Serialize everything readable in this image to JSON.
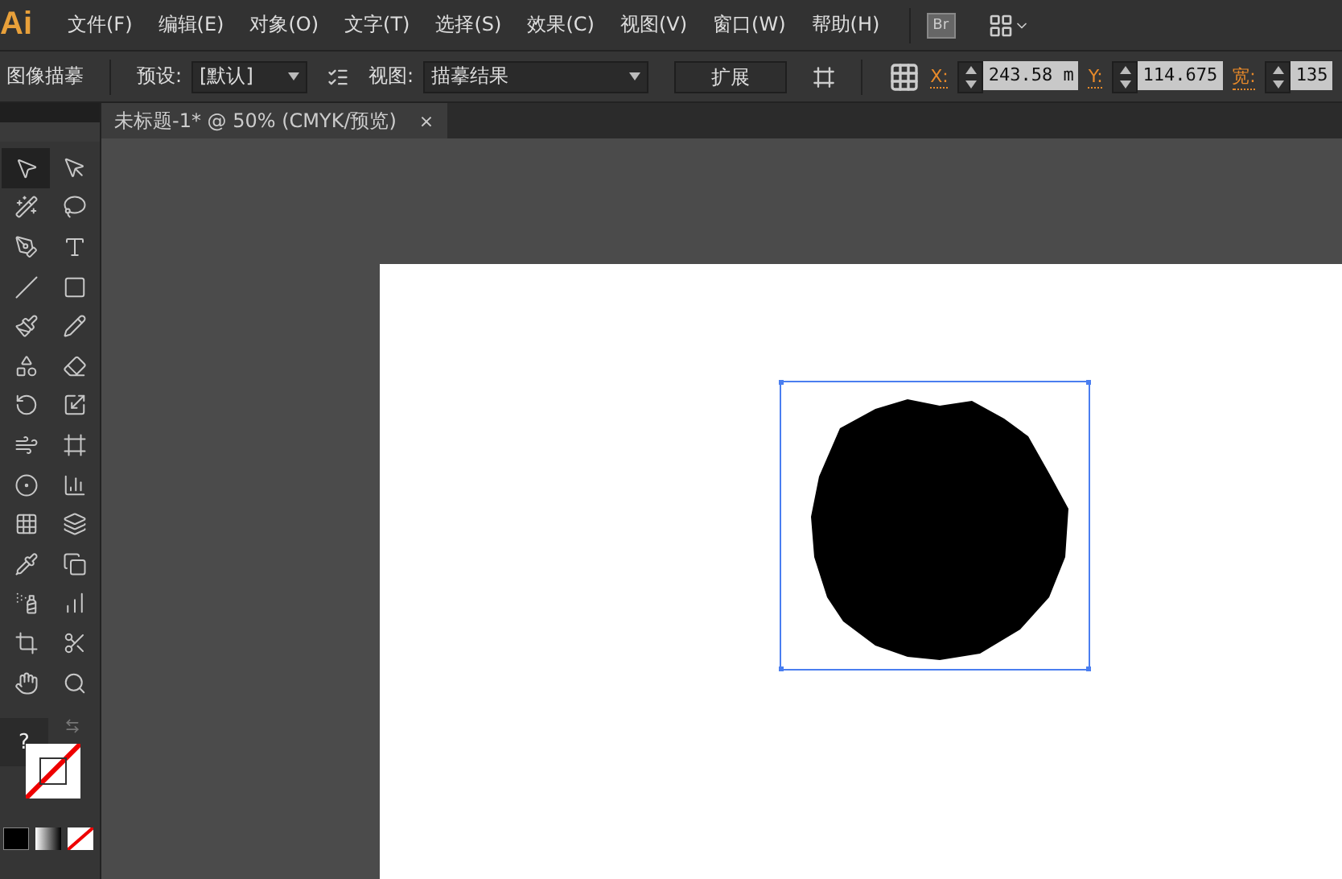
{
  "app": {
    "logo": "Ai"
  },
  "menu": [
    "文件(F)",
    "编辑(E)",
    "对象(O)",
    "文字(T)",
    "选择(S)",
    "效果(C)",
    "视图(V)",
    "窗口(W)",
    "帮助(H)"
  ],
  "bridge": {
    "label": "Br"
  },
  "control_bar": {
    "title": "图像描摹",
    "preset_label": "预设:",
    "preset_value": "[默认]",
    "view_label": "视图:",
    "view_value": "描摹结果",
    "expand_button": "扩展",
    "fields": [
      {
        "label": "X:",
        "value": "243.58 m"
      },
      {
        "label": "Y:",
        "value": "114.675"
      },
      {
        "label": "宽:",
        "value": "135"
      }
    ]
  },
  "document_tab": {
    "title": "未标题-1* @ 50% (CMYK/预览)",
    "close": "×"
  },
  "tools": [
    {
      "selected": true
    },
    {
      "selected": false
    },
    {
      "selected": false
    },
    {
      "selected": false
    },
    {
      "selected": false
    },
    {
      "selected": false
    },
    {
      "selected": false
    },
    {
      "selected": false
    },
    {
      "selected": false
    },
    {
      "selected": false
    },
    {
      "selected": false
    },
    {
      "selected": false
    },
    {
      "selected": false
    },
    {
      "selected": false
    },
    {
      "selected": false
    },
    {
      "selected": false
    },
    {
      "selected": false
    },
    {
      "selected": false
    },
    {
      "selected": false
    },
    {
      "selected": false
    },
    {
      "selected": false
    },
    {
      "selected": false
    },
    {
      "selected": false
    },
    {
      "selected": false
    },
    {
      "selected": false
    },
    {
      "selected": false
    },
    {
      "selected": false
    },
    {
      "selected": false
    }
  ],
  "tooltip": {
    "text": "?"
  },
  "canvas": {
    "selected": true
  }
}
